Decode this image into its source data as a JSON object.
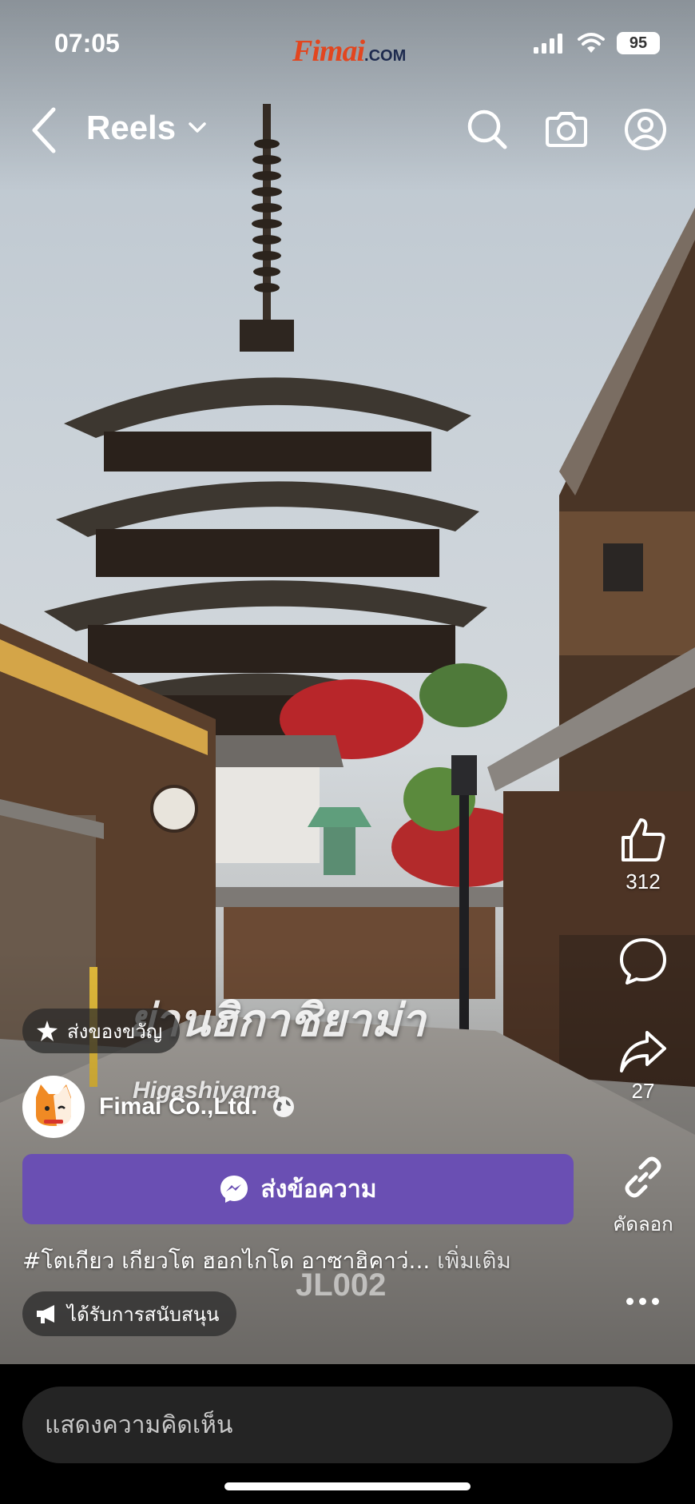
{
  "status_bar": {
    "time": "07:05",
    "brand": "Fimai",
    "brand_suffix": ".COM",
    "battery": "95",
    "icons": [
      "signal-icon",
      "wifi-icon",
      "battery-icon"
    ]
  },
  "nav": {
    "title": "Reels",
    "icons": [
      "back-icon",
      "chevron-down-icon",
      "search-icon",
      "camera-icon",
      "profile-icon"
    ]
  },
  "video": {
    "caption_th": "ย่านฮิกาชิยาม่า",
    "caption_en": "Higashiyama",
    "watermark": "JL002"
  },
  "rail": {
    "like_count": "312",
    "share_count": "27",
    "copy_label": "คัดลอก",
    "icons": [
      "like-icon",
      "comment-icon",
      "share-icon",
      "link-icon",
      "more-icon"
    ]
  },
  "meta": {
    "gift_label": "ส่งของขวัญ",
    "page_name": "Fimai Co.,Ltd.",
    "message_button": "ส่งข้อความ",
    "description": "#โตเกียว เกียวโต ฮอกไกโด อาซาฮิคาว่... ",
    "more_label": "เพิ่มเติม",
    "sponsored_label": "ได้รับการสนับสนุน"
  },
  "comment": {
    "placeholder": "แสดงความคิดเห็น"
  },
  "colors": {
    "message_button": "#6a4fb3",
    "brand": "#e2461f"
  }
}
